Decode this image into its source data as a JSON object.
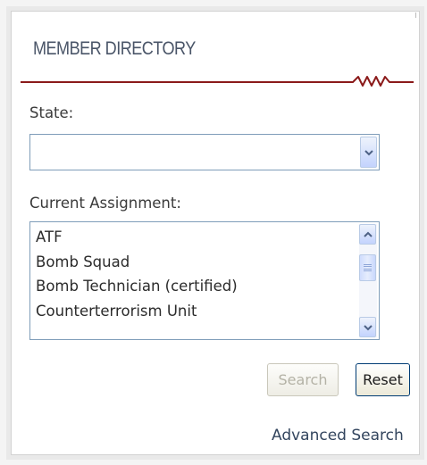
{
  "widget": {
    "title": "MEMBER DIRECTORY",
    "accent_color": "#8b1a1a"
  },
  "state_field": {
    "label": "State:",
    "selected_value": "",
    "dropdown_icon": "chevron-down-icon"
  },
  "assignment_field": {
    "label": "Current Assignment:",
    "options": [
      "ATF",
      "Bomb Squad",
      "Bomb Technician (certified)",
      "Counterterrorism Unit"
    ]
  },
  "buttons": {
    "search_label": "Search",
    "search_enabled": false,
    "reset_label": "Reset"
  },
  "links": {
    "advanced_search": "Advanced Search"
  }
}
